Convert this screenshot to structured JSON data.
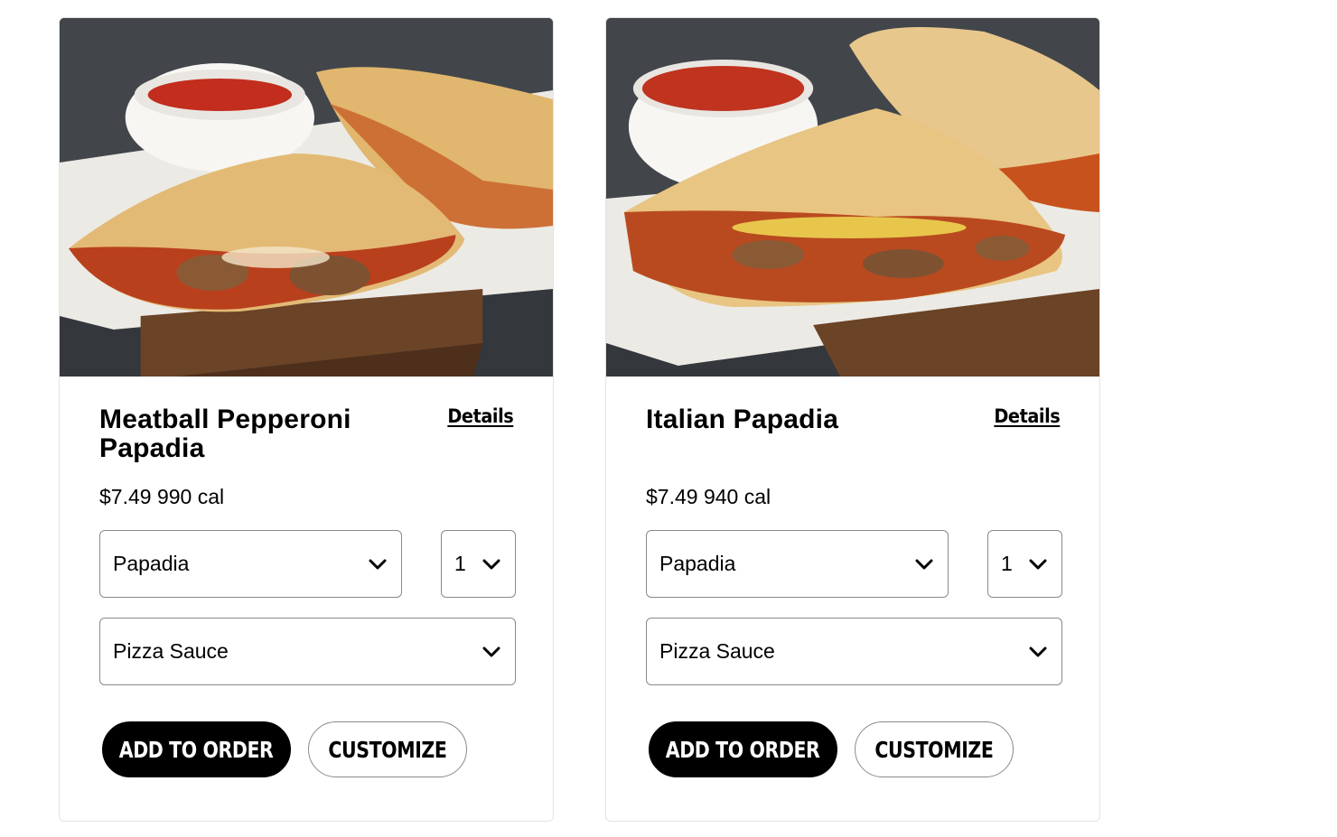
{
  "products": [
    {
      "name": "Meatball Pepperoni Papadia",
      "details_label": "Details",
      "price_cal": "$7.49 990 cal",
      "size_select": "Papadia",
      "quantity_select": "1",
      "sauce_select": "Pizza Sauce",
      "add_label": "ADD TO ORDER",
      "customize_label": "CUSTOMIZE"
    },
    {
      "name": "Italian Papadia",
      "details_label": "Details",
      "price_cal": "$7.49 940 cal",
      "size_select": "Papadia",
      "quantity_select": "1",
      "sauce_select": "Pizza Sauce",
      "add_label": "ADD TO ORDER",
      "customize_label": "CUSTOMIZE"
    }
  ],
  "colors": {
    "primary_button": "#000000",
    "card_border": "#e3e3e3",
    "select_border": "#8a8a8a"
  },
  "icons": {
    "select_arrow": "chevron-down-icon"
  }
}
